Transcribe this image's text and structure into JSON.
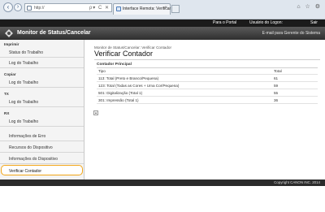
{
  "browser": {
    "address": "http://",
    "address_tools": "ρ▾ C ✕",
    "tab_title": "Interface Remota: Verificar ...",
    "tab_close": "×",
    "window_icons": "⌂ ☆ ⚙"
  },
  "topbar": {
    "portal_link": "Para o Portal",
    "user_label": "Usuário do Logon:",
    "logout_label": "Sair"
  },
  "header": {
    "title": "Monitor de Status/Cancelar",
    "admin_email": "E-mail para Gerente do Sistema"
  },
  "sidebar": {
    "sections": [
      {
        "heading": "Imprimir",
        "items": [
          "Status do Trabalho",
          "Log do Trabalho"
        ]
      },
      {
        "heading": "Copiar",
        "items": [
          "Log do Trabalho"
        ]
      },
      {
        "heading": "TX",
        "items": [
          "Log do Trabalho"
        ]
      },
      {
        "heading": "RX",
        "items": [
          "Log do Trabalho"
        ]
      }
    ],
    "extra_items": [
      "Informações de Erro",
      "Recursos do Dispositivo",
      "Informações do Dispositivo",
      "Verificar Contador"
    ],
    "active_item": "Verificar Contador"
  },
  "main": {
    "breadcrumb": "Monitor de Status/Cancelar: Verificar Contador",
    "title": "Verificar Contador",
    "section_title": "Contador Principal",
    "columns": [
      "Tipo",
      "Total"
    ],
    "rows": [
      {
        "type": "113: Total (Preto e Branco/Pequena)",
        "total": "61"
      },
      {
        "type": "123: Total (Todas as Cores + Uma Cor/Pequena)",
        "total": "59"
      },
      {
        "type": "501: Digitalização (Total 1)",
        "total": "55"
      },
      {
        "type": "301: Impressão (Total 1)",
        "total": "36"
      }
    ]
  },
  "footer": {
    "copyright": "Copyright CANON INC. 2014"
  }
}
